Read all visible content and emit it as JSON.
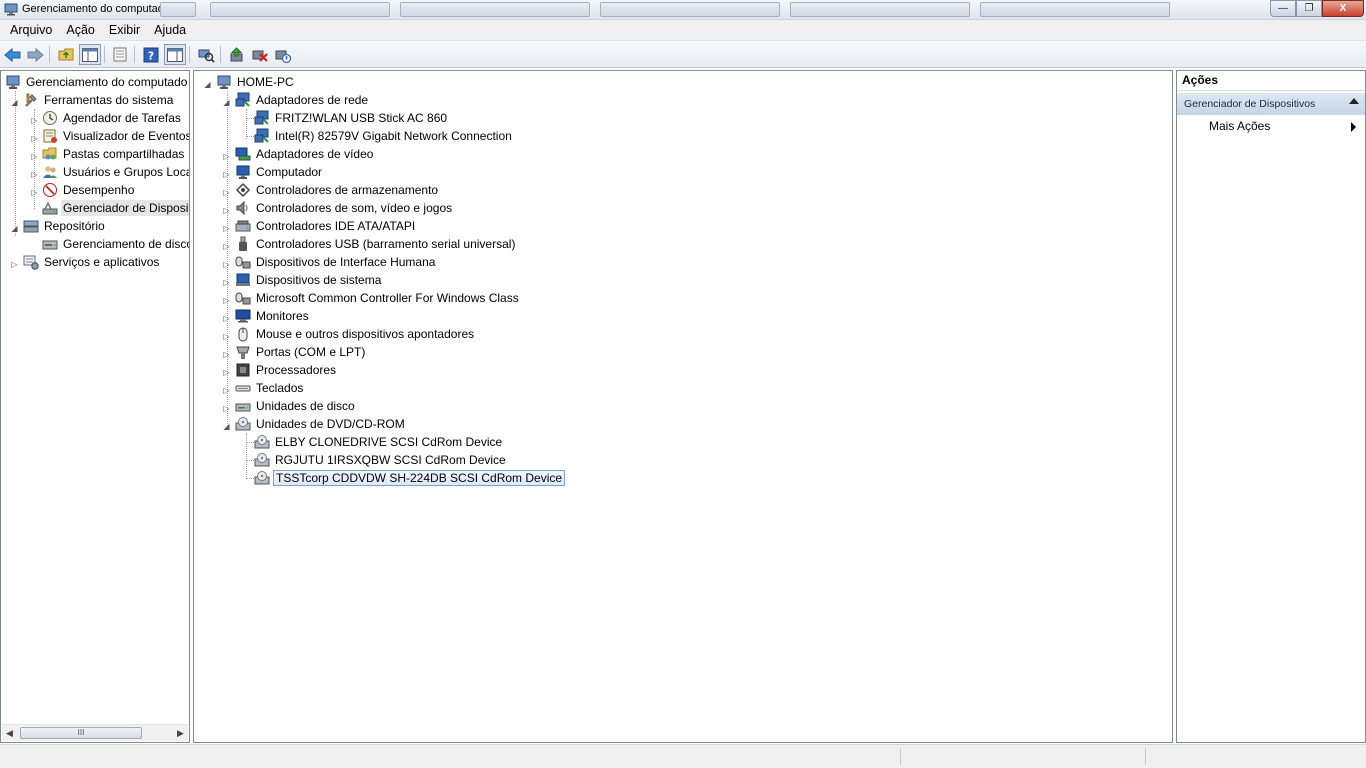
{
  "window": {
    "title": "Gerenciamento do computador"
  },
  "menu": [
    "Arquivo",
    "Ação",
    "Exibir",
    "Ajuda"
  ],
  "left_tree": {
    "root": "Gerenciamento do computado",
    "ferramentas": "Ferramentas do sistema",
    "agendador": "Agendador de Tarefas",
    "visualizador": "Visualizador de Eventos",
    "pastas": "Pastas compartilhadas",
    "usuarios": "Usuários e Grupos Loca",
    "desempenho": "Desempenho",
    "gerenciador": "Gerenciador de Disposit",
    "repositorio": "Repositório",
    "gerenciamento_disco": "Gerenciamento de disco",
    "servicos": "Serviços e aplicativos"
  },
  "device_tree": {
    "root": "HOME-PC",
    "categories": [
      {
        "label": "Adaptadores de rede",
        "children": [
          "FRITZ!WLAN USB Stick AC 860",
          "Intel(R) 82579V Gigabit Network Connection"
        ]
      },
      {
        "label": "Adaptadores de vídeo"
      },
      {
        "label": "Computador"
      },
      {
        "label": "Controladores de armazenamento"
      },
      {
        "label": "Controladores de som, vídeo e jogos"
      },
      {
        "label": "Controladores IDE ATA/ATAPI"
      },
      {
        "label": "Controladores USB (barramento serial universal)"
      },
      {
        "label": "Dispositivos de Interface Humana"
      },
      {
        "label": "Dispositivos de sistema"
      },
      {
        "label": "Microsoft Common Controller For Windows Class"
      },
      {
        "label": "Monitores"
      },
      {
        "label": "Mouse e outros dispositivos apontadores"
      },
      {
        "label": "Portas (COM e LPT)"
      },
      {
        "label": "Processadores"
      },
      {
        "label": "Teclados"
      },
      {
        "label": "Unidades de disco"
      },
      {
        "label": "Unidades de DVD/CD-ROM",
        "children": [
          "ELBY CLONEDRIVE SCSI CdRom Device",
          "RGJUTU 1IRSXQBW SCSI CdRom Device",
          "TSSTcorp CDDVDW SH-224DB SCSI CdRom Device"
        ]
      }
    ]
  },
  "actions": {
    "header": "Ações",
    "section": "Gerenciador de Dispositivos",
    "more": "Mais Ações"
  },
  "scrollbar": {
    "grip": "III"
  },
  "window_buttons": {
    "minimize": "—",
    "maximize": "❐",
    "close": "X"
  }
}
